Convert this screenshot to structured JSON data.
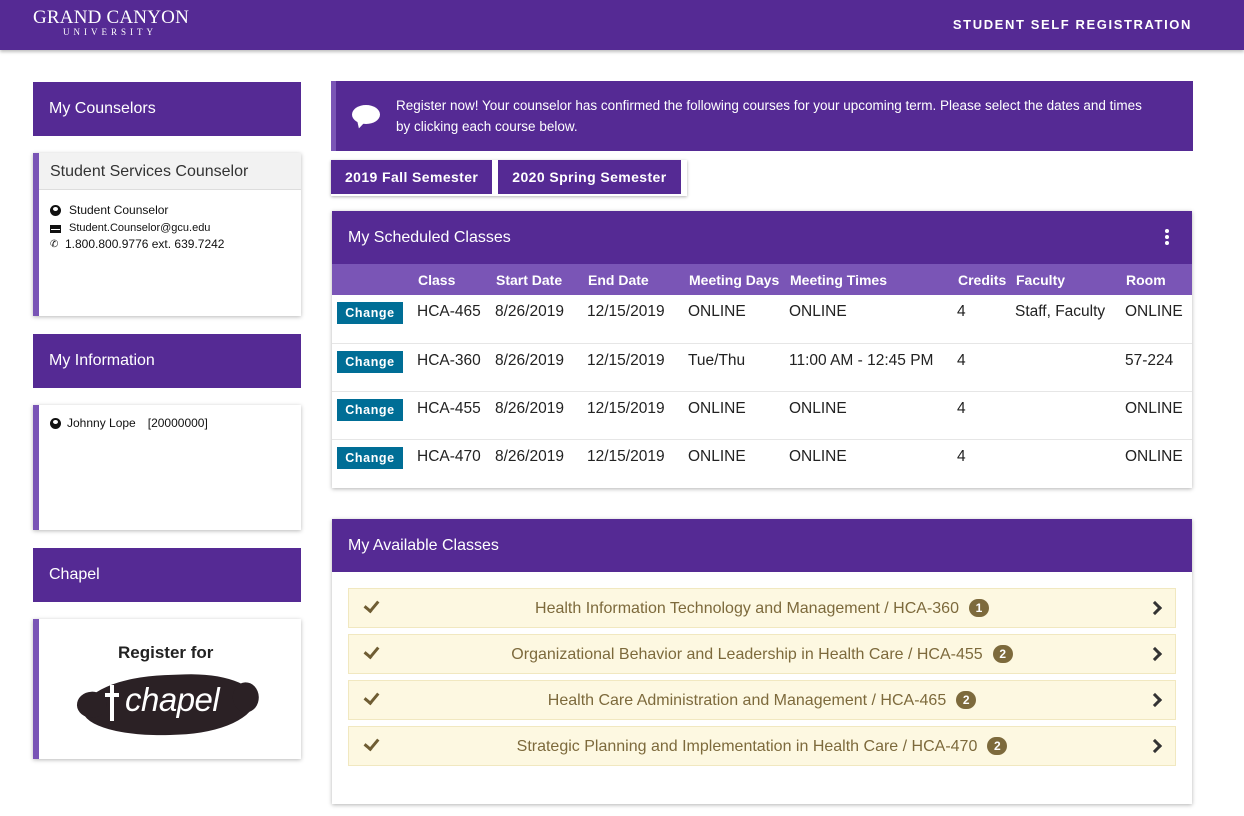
{
  "header": {
    "logo_main": "GRAND CANYON",
    "logo_sub": "UNIVERSITY",
    "title": "STUDENT SELF REGISTRATION"
  },
  "sidebar": {
    "counselors": {
      "heading": "My Counselors",
      "card_title": "Student Services Counselor",
      "name": "Student Counselor",
      "email": "Student.Counselor@gcu.edu",
      "phone": "1.800.800.9776 ext. 639.7242"
    },
    "information": {
      "heading": "My Information",
      "student_name": "Johnny Lope",
      "student_id": "[20000000]"
    },
    "chapel": {
      "heading": "Chapel",
      "register_text": "Register for",
      "logo_word": "chapel"
    }
  },
  "notice": {
    "text": "Register now! Your counselor has confirmed the following courses for your upcoming term. Please select the dates and times by clicking each course below."
  },
  "semesters": [
    "2019 Fall Semester",
    "2020 Spring Semester"
  ],
  "scheduled": {
    "heading": "My Scheduled Classes",
    "columns": [
      "",
      "Class",
      "Start Date",
      "End Date",
      "Meeting Days",
      "Meeting Times",
      "Credits",
      "Faculty",
      "Room"
    ],
    "change_label": "Change",
    "rows": [
      {
        "class": "HCA-465",
        "start": "8/26/2019",
        "end": "12/15/2019",
        "days": "ONLINE",
        "times": "ONLINE",
        "credits": "4",
        "faculty": "Staff, Faculty",
        "room": "ONLINE"
      },
      {
        "class": "HCA-360",
        "start": "8/26/2019",
        "end": "12/15/2019",
        "days": "Tue/Thu",
        "times": "11:00 AM - 12:45 PM",
        "credits": "4",
        "faculty": "",
        "room": "57-224"
      },
      {
        "class": "HCA-455",
        "start": "8/26/2019",
        "end": "12/15/2019",
        "days": "ONLINE",
        "times": "ONLINE",
        "credits": "4",
        "faculty": "",
        "room": "ONLINE"
      },
      {
        "class": "HCA-470",
        "start": "8/26/2019",
        "end": "12/15/2019",
        "days": "ONLINE",
        "times": "ONLINE",
        "credits": "4",
        "faculty": "",
        "room": "ONLINE"
      }
    ]
  },
  "available": {
    "heading": "My Available Classes",
    "items": [
      {
        "title": "Health Information Technology and Management / HCA-360",
        "count": "1"
      },
      {
        "title": "Organizational Behavior and Leadership in Health Care / HCA-455",
        "count": "2"
      },
      {
        "title": "Health Care Administration and Management / HCA-465",
        "count": "2"
      },
      {
        "title": "Strategic Planning and Implementation in Health Care / HCA-470",
        "count": "2"
      }
    ]
  }
}
